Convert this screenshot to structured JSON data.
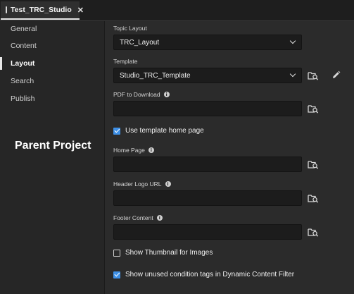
{
  "tab": {
    "title": "Test_TRC_Studio",
    "close": "✕",
    "icon": "document-icon"
  },
  "sidebar": {
    "items": [
      {
        "label": "General"
      },
      {
        "label": "Content"
      },
      {
        "label": "Layout",
        "active": true
      },
      {
        "label": "Search"
      },
      {
        "label": "Publish"
      }
    ]
  },
  "overlay": {
    "label": "Parent Project"
  },
  "form": {
    "topic_layout": {
      "label": "Topic Layout",
      "value": "TRC_Layout"
    },
    "template": {
      "label": "Template",
      "value": "Studio_TRC_Template"
    },
    "pdf": {
      "label": "PDF to Download",
      "value": ""
    },
    "use_template_home": {
      "label": "Use template home page",
      "checked": true
    },
    "home_page": {
      "label": "Home Page",
      "value": ""
    },
    "header_logo": {
      "label": "Header Logo URL",
      "value": ""
    },
    "footer": {
      "label": "Footer Content",
      "value": ""
    },
    "show_thumbnail": {
      "label": "Show Thumbnail for Images",
      "checked": false
    },
    "show_unused": {
      "label": "Show unused condition tags in Dynamic Content Filter",
      "checked": true
    },
    "info_glyph": "i"
  },
  "colors": {
    "accent": "#3d8fe6",
    "background": "#2b2b2b",
    "sidebar": "#262626",
    "field": "#1c1c1c"
  }
}
